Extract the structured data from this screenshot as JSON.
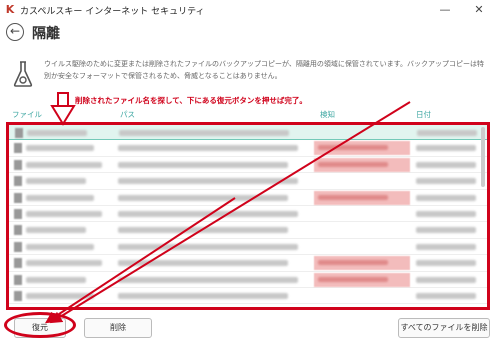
{
  "window": {
    "title": "カスペルスキー インターネット セキュリティ",
    "minimize": "—",
    "close": "✕"
  },
  "header": {
    "back": "←",
    "title": "隔離"
  },
  "description": "ウイルス駆除のために変更または削除されたファイルのバックアップコピーが、隔離用の領域に保管されています。バックアップコピーは特別か安全なフォーマットで保管されるため、脅威となることはありません。",
  "annotation": "削除されたファイル名を探して、下にある復元ボタンを押せば完了。",
  "columns": {
    "file": "ファイル",
    "path": "パス",
    "detect": "検知",
    "date": "日付"
  },
  "rows": [
    {
      "selected": true,
      "detect": false
    },
    {
      "selected": false,
      "detect": true
    },
    {
      "selected": false,
      "detect": true
    },
    {
      "selected": false,
      "detect": false
    },
    {
      "selected": false,
      "detect": true
    },
    {
      "selected": false,
      "detect": false
    },
    {
      "selected": false,
      "detect": false
    },
    {
      "selected": false,
      "detect": false
    },
    {
      "selected": false,
      "detect": true
    },
    {
      "selected": false,
      "detect": true
    },
    {
      "selected": false,
      "detect": false
    }
  ],
  "buttons": {
    "restore": "復元",
    "delete": "削除",
    "delete_all": "すべてのファイルを削除"
  },
  "colors": {
    "accent": "#3aa5a0",
    "annotation": "#d0021b",
    "selected_row": "#e1f4ef",
    "detect_badge": "#f3bcbc"
  }
}
